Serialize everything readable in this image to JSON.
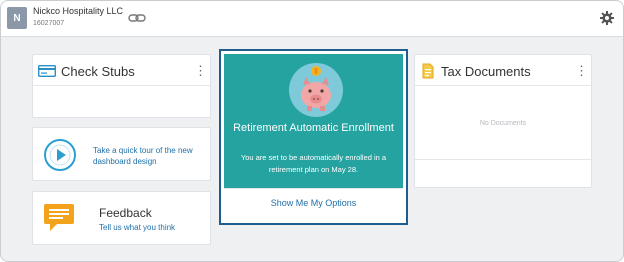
{
  "header": {
    "avatar_initial": "N",
    "company_name": "Nickco Hospitality LLC",
    "company_id": "16027007"
  },
  "check_stubs": {
    "title": "Check Stubs",
    "menu_glyph": "⋮"
  },
  "tour": {
    "text": "Take a quick tour of the new dashboard design"
  },
  "feedback": {
    "title": "Feedback",
    "link": "Tell us what you think"
  },
  "retirement": {
    "title": "Retirement Automatic Enrollment",
    "text": "You are set to be automatically enrolled in a retirement plan on May 28.",
    "link": "Show Me My Options"
  },
  "tax_documents": {
    "title": "Tax Documents",
    "menu_glyph": "⋮",
    "empty_text": "No Documents"
  },
  "colors": {
    "teal": "#24a3a0",
    "link_blue": "#1e6fa8",
    "focus_border": "#1f5e8c",
    "icon_orange": "#f2a31b"
  }
}
